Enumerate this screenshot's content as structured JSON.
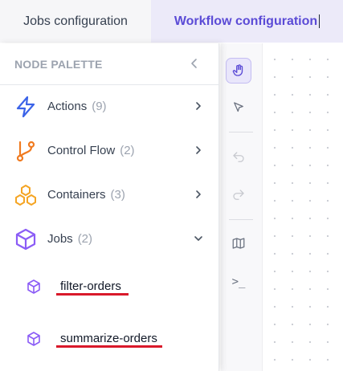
{
  "tabs": [
    {
      "label": "Jobs configuration"
    },
    {
      "label": "Workflow configuration"
    }
  ],
  "palette": {
    "title": "NODE PALETTE",
    "categories": [
      {
        "label": "Actions",
        "count": "(9)",
        "icon": "lightning-icon",
        "color": "#3b63e8"
      },
      {
        "label": "Control Flow",
        "count": "(2)",
        "icon": "branch-icon",
        "color": "#f07a1f"
      },
      {
        "label": "Containers",
        "count": "(3)",
        "icon": "cubes-icon",
        "color": "#f5a524"
      },
      {
        "label": "Jobs",
        "count": "(2)",
        "icon": "cube-icon",
        "color": "#8b5cf6"
      }
    ],
    "jobs": [
      {
        "label": "filter-orders",
        "icon": "cube-icon"
      },
      {
        "label": "summarize-orders",
        "icon": "cube-icon"
      }
    ]
  },
  "toolbar": [
    {
      "icon": "hand-icon",
      "active": true
    },
    {
      "icon": "pointer-icon"
    },
    {
      "icon": "undo-icon"
    },
    {
      "icon": "redo-icon"
    },
    {
      "icon": "map-icon"
    },
    {
      "icon": "terminal-icon",
      "glyph": ">_"
    }
  ],
  "colors": {
    "accent": "#5b4bd6",
    "underline": "#d9192a"
  }
}
